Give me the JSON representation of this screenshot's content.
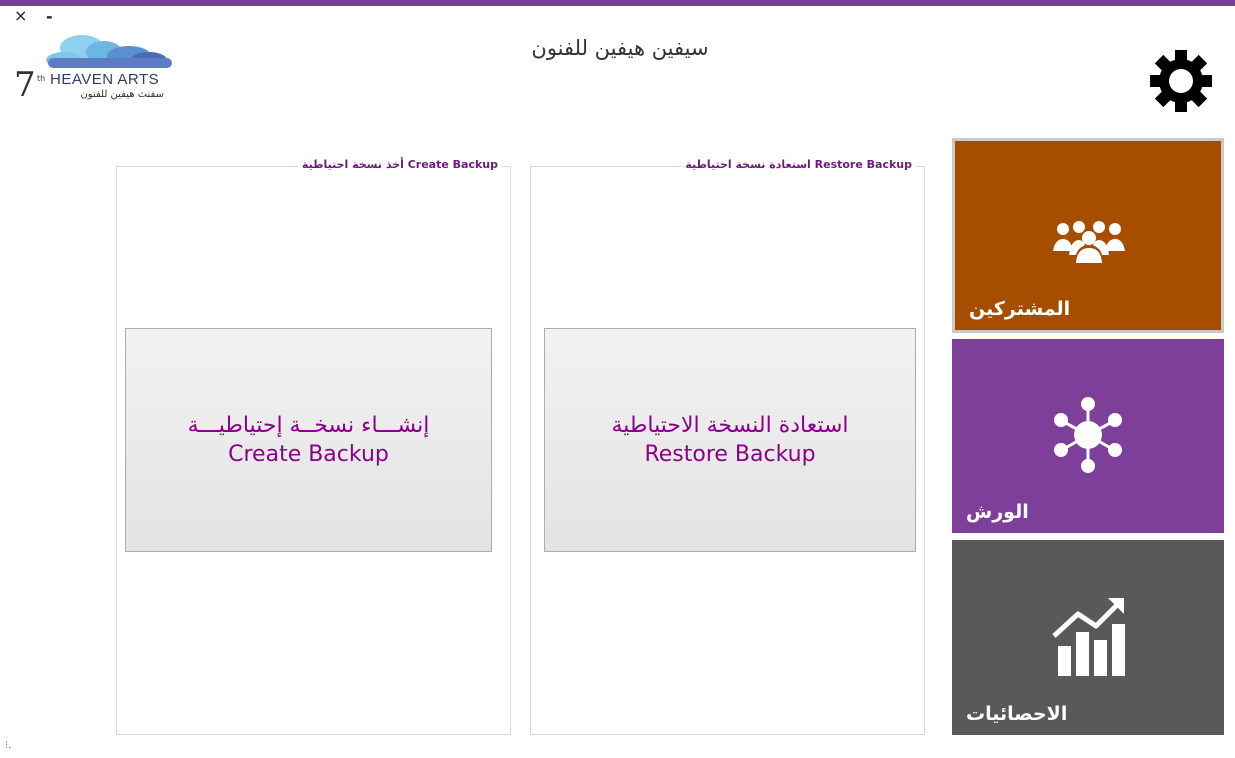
{
  "window": {
    "close_label": "×",
    "minimize_label": "-",
    "title": "سيفين هيفين للفنون"
  },
  "logo": {
    "number": "7",
    "superscript": "th",
    "brand_en": "HEAVEN ARTS",
    "brand_ar": "سفنث هيفين للفنون"
  },
  "settings": {
    "icon": "gear-icon"
  },
  "create_group": {
    "legend": "أخذ نسخة احتياطية Create Backup",
    "button_ar": "إنشـــاء نسخــة إحتياطيـــة",
    "button_en": "Create Backup"
  },
  "restore_group": {
    "legend": "استعادة نسخة احتياطية Restore Backup",
    "button_ar": "استعادة النسخة الاحتياطية",
    "button_en": "Restore Backup"
  },
  "tiles": [
    {
      "label": "المشتركين",
      "icon": "users-group-icon",
      "color": "#a64d00"
    },
    {
      "label": "الورش",
      "icon": "network-hub-icon",
      "color": "#7d3f9a"
    },
    {
      "label": "الاحصائيات",
      "icon": "stats-chart-icon",
      "color": "#595959"
    }
  ],
  "colors": {
    "accent_bar": "#7b3f9a",
    "button_text": "#8b008b",
    "legend_text": "#6d1a7e"
  }
}
